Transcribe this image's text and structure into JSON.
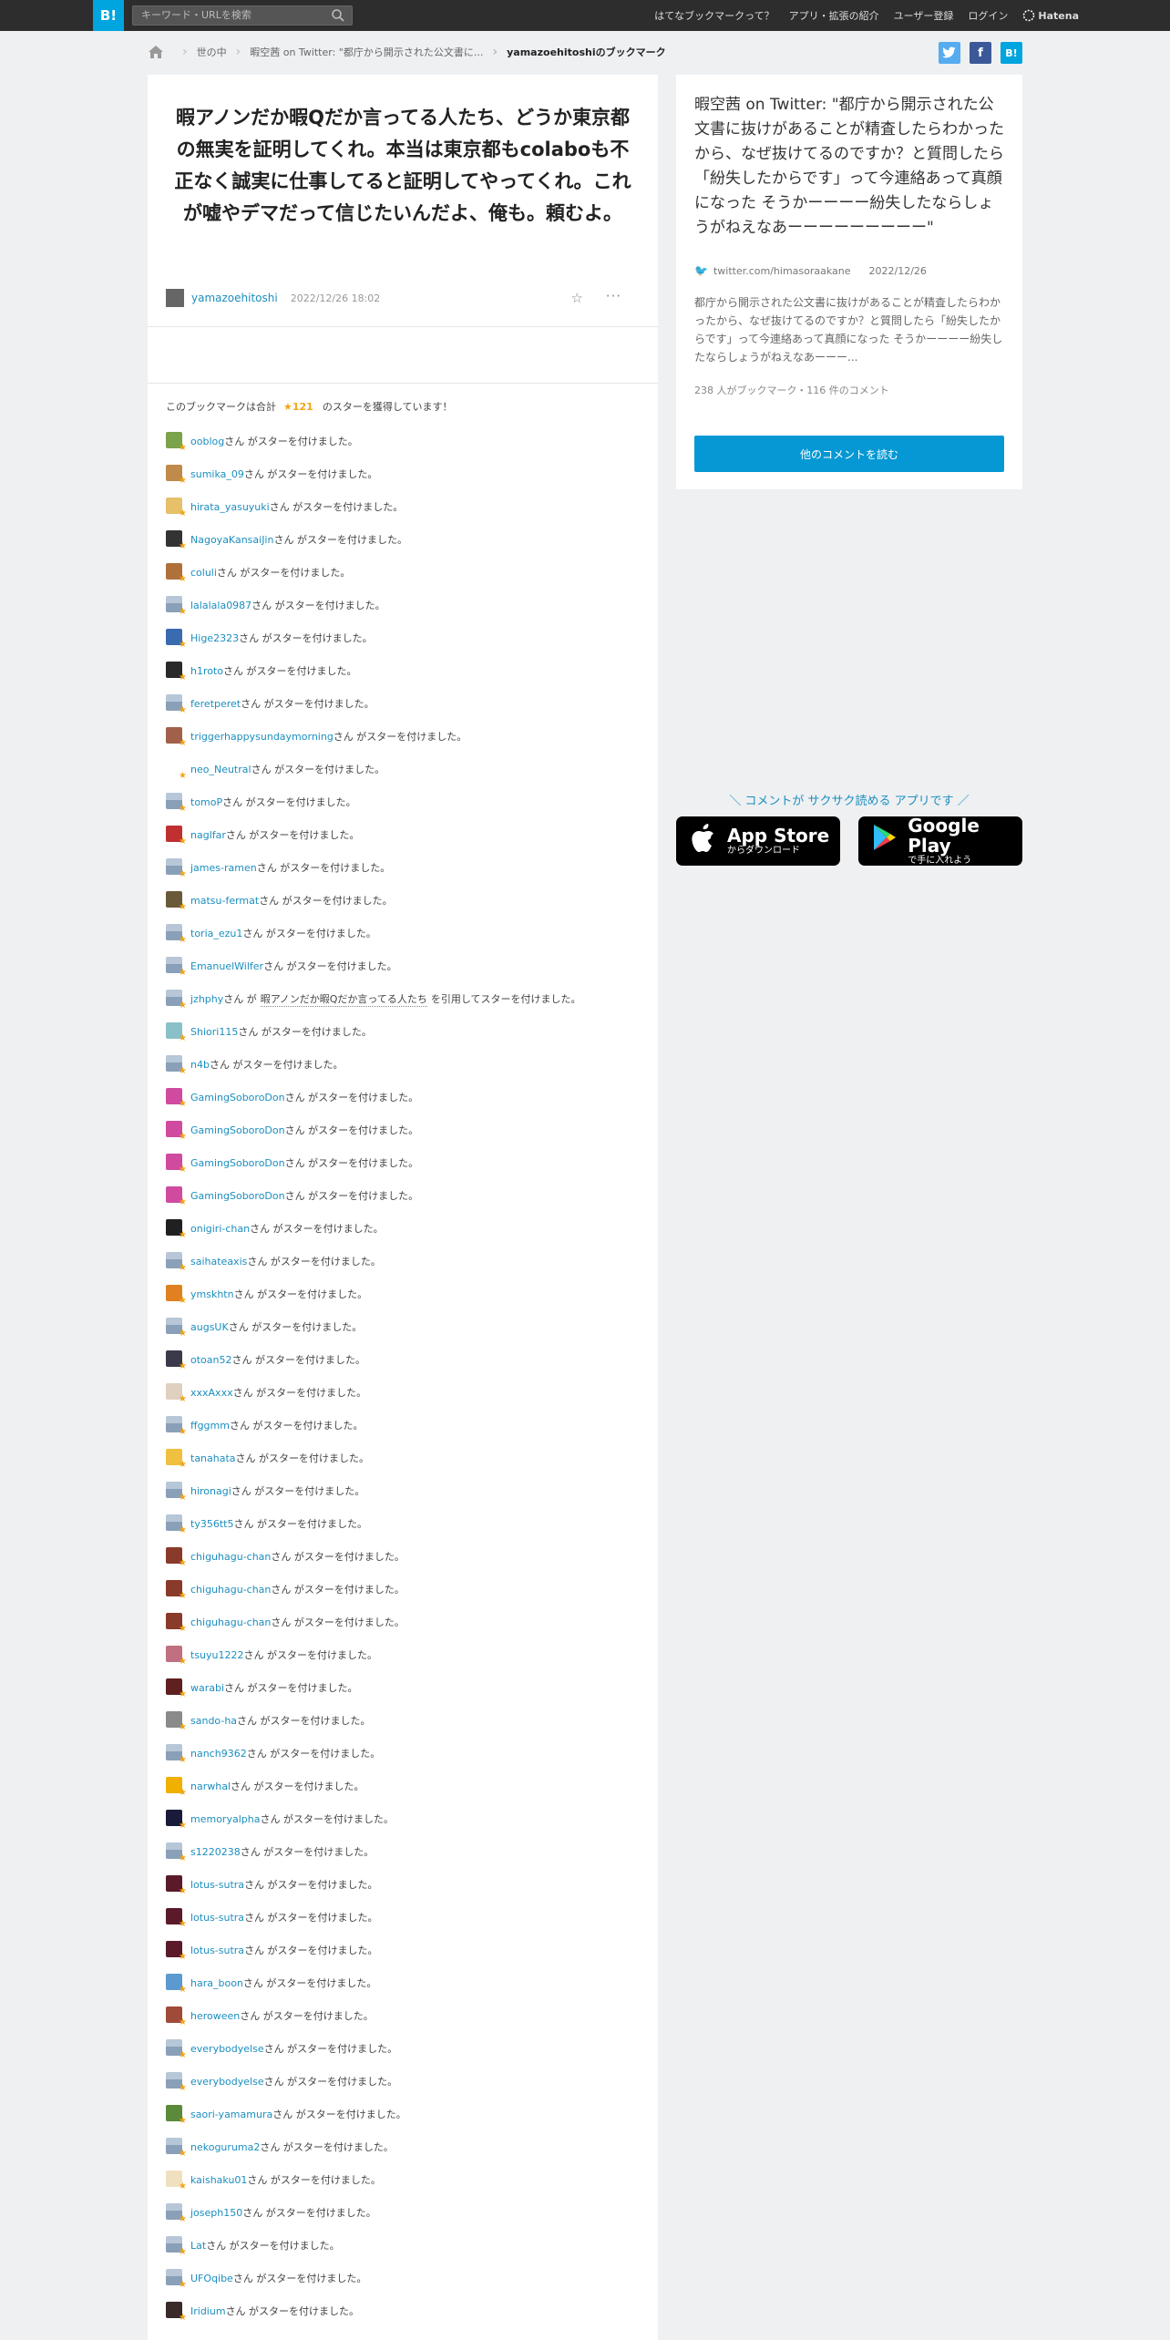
{
  "header": {
    "logo": "B!",
    "search_placeholder": "キーワード・URLを検索",
    "nav": [
      "はてなブックマークって？",
      "アプリ・拡張の紹介",
      "ユーザー登録",
      "ログイン"
    ],
    "brand": "Hatena"
  },
  "breadcrumb": {
    "items": [
      "世の中",
      "暇空茜 on Twitter: \"都庁から開示された公文書に..."
    ],
    "current": "yamazoehitoshiのブックマーク"
  },
  "share": {
    "twitter": "t",
    "facebook": "f",
    "hatena": "B!"
  },
  "bookmark": {
    "comment": "暇アノンだか暇Qだか言ってる人たち、どうか東京都の無実を証明してくれ。本当は東京都もcolaboも不正なく誠実に仕事してると証明してやってくれ。これが嘘やデマだって信じたいんだよ、俺も。頼むよ。",
    "user": "yamazoehitoshi",
    "date": "2022/12/26 18:02",
    "star_add": "☆",
    "more": "···"
  },
  "star_summary": {
    "prefix": "このブックマークは合計",
    "count": "121",
    "suffix": "のスターを獲得しています！"
  },
  "star_suffix": "さん がスターを付けました。",
  "star_quote_mid": "さん が",
  "star_quote_end": "を引用してスターを付けました。",
  "stars": [
    {
      "user": "ooblog",
      "color": "#7aa34a"
    },
    {
      "user": "sumika_09",
      "color": "#c08a4a"
    },
    {
      "user": "hirata_yasuyuki",
      "color": "#e6c16a"
    },
    {
      "user": "NagoyaKansaiJin",
      "color": "#333333"
    },
    {
      "user": "coluli",
      "color": "#b0703a"
    },
    {
      "user": "lalalala0987",
      "color": "#9bb0c8"
    },
    {
      "user": "Hige2323",
      "color": "#3a6ab0"
    },
    {
      "user": "h1roto",
      "color": "#2a2a2a"
    },
    {
      "user": "feretperet",
      "color": "#9bb0c8"
    },
    {
      "user": "triggerhappysundaymorning",
      "color": "#a0604a"
    },
    {
      "user": "neo_Neutral",
      "color": "#ffffff"
    },
    {
      "user": "tomoP",
      "color": "#9bb0c8"
    },
    {
      "user": "naglfar",
      "color": "#c03030"
    },
    {
      "user": "james-ramen",
      "color": "#9bb0c8"
    },
    {
      "user": "matsu-fermat",
      "color": "#6a5a3a"
    },
    {
      "user": "toria_ezu1",
      "color": "#9bb0c8"
    },
    {
      "user": "EmanuelWilfer",
      "color": "#9bb0c8"
    },
    {
      "user": "jzhphy",
      "color": "#9bb0c8",
      "quote": "暇アノンだか暇Qだか言ってる人たち"
    },
    {
      "user": "Shiori115",
      "color": "#8ac0c8"
    },
    {
      "user": "n4b",
      "color": "#9bb0c8"
    },
    {
      "user": "GamingSoboroDon",
      "color": "#d04aa0"
    },
    {
      "user": "GamingSoboroDon",
      "color": "#d04aa0"
    },
    {
      "user": "GamingSoboroDon",
      "color": "#d04aa0"
    },
    {
      "user": "GamingSoboroDon",
      "color": "#d04aa0"
    },
    {
      "user": "onigiri-chan",
      "color": "#202020"
    },
    {
      "user": "saihateaxis",
      "color": "#9bb0c8"
    },
    {
      "user": "ymskhtn",
      "color": "#e08020"
    },
    {
      "user": "augsUK",
      "color": "#9bb0c8"
    },
    {
      "user": "otoan52",
      "color": "#3a3a4a"
    },
    {
      "user": "xxxAxxx",
      "color": "#e0d0c0"
    },
    {
      "user": "ffggmm",
      "color": "#9bb0c8"
    },
    {
      "user": "tanahata",
      "color": "#f0c040"
    },
    {
      "user": "hironagi",
      "color": "#9bb0c8"
    },
    {
      "user": "ty356tt5",
      "color": "#9bb0c8"
    },
    {
      "user": "chiguhagu-chan",
      "color": "#8a3a2a"
    },
    {
      "user": "chiguhagu-chan",
      "color": "#8a3a2a"
    },
    {
      "user": "chiguhagu-chan",
      "color": "#8a3a2a"
    },
    {
      "user": "tsuyu1222",
      "color": "#c07080"
    },
    {
      "user": "warabi",
      "color": "#602020"
    },
    {
      "user": "sando-ha",
      "color": "#8a8a8a"
    },
    {
      "user": "nanch9362",
      "color": "#9bb0c8"
    },
    {
      "user": "narwhal",
      "color": "#f0b000"
    },
    {
      "user": "memoryalpha",
      "color": "#1a1a3a"
    },
    {
      "user": "s1220238",
      "color": "#9bb0c8"
    },
    {
      "user": "lotus-sutra",
      "color": "#5a1a2a"
    },
    {
      "user": "lotus-sutra",
      "color": "#5a1a2a"
    },
    {
      "user": "lotus-sutra",
      "color": "#5a1a2a"
    },
    {
      "user": "hara_boon",
      "color": "#5a9ad0"
    },
    {
      "user": "heroween",
      "color": "#a04a3a"
    },
    {
      "user": "everybodyelse",
      "color": "#9bb0c8"
    },
    {
      "user": "everybodyelse",
      "color": "#9bb0c8"
    },
    {
      "user": "saori-yamamura",
      "color": "#5a8a3a"
    },
    {
      "user": "nekoguruma2",
      "color": "#9bb0c8"
    },
    {
      "user": "kaishaku01",
      "color": "#f0e0c0"
    },
    {
      "user": "joseph150",
      "color": "#9bb0c8"
    },
    {
      "user": "Lat",
      "color": "#9bb0c8"
    },
    {
      "user": "UFOqibe",
      "color": "#9bb0c8"
    },
    {
      "user": "Iridium",
      "color": "#3a2a2a"
    }
  ],
  "sidebar": {
    "title": "暇空茜 on Twitter: \"都庁から開示された公文書に抜けがあることが精査したらわかったから、なぜ抜けてるのですか？と質問したら「紛失したからです」って今連絡あって真顔になった そうかーーーー紛失したならしょうがねえなあーーーーーーーーー\"",
    "source": "twitter.com/himasoraakane",
    "date": "2022/12/26",
    "excerpt": "都庁から開示された公文書に抜けがあることが精査したらわかったから、なぜ抜けてるのですか？と質問したら「紛失したからです」って今連絡あって真顔になった そうかーーーー紛失したならしょうがねえなあーーー...",
    "meta": "238 人がブックマーク・116 件のコメント",
    "button": "他のコメントを読む"
  },
  "promo": {
    "text": "＼ コメントが サクサク読める アプリです ／",
    "appstore_big": "App Store",
    "appstore_small": "からダウンロード",
    "googleplay_big": "Google Play",
    "googleplay_small": "で手に入れよう"
  }
}
